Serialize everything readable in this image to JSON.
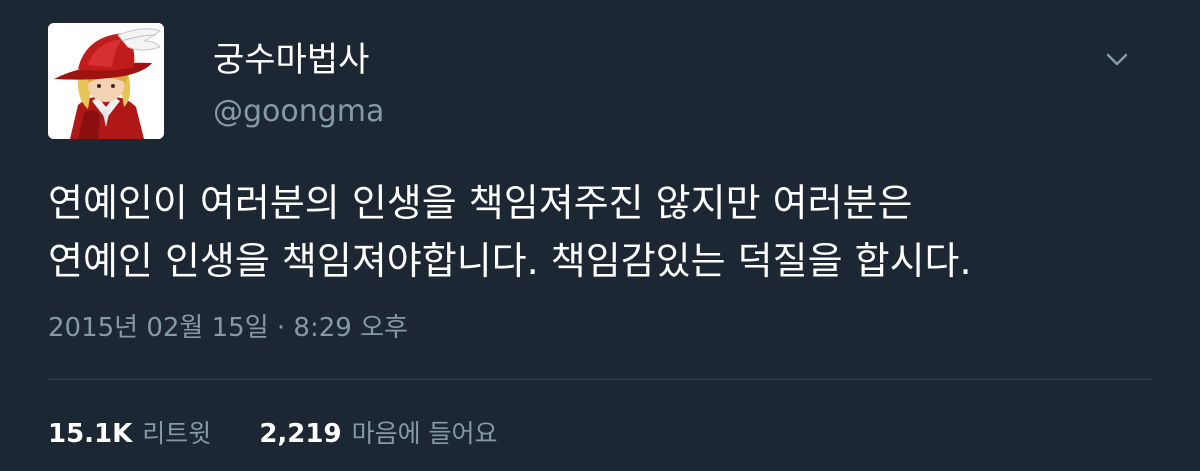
{
  "tweet": {
    "display_name": "궁수마법사",
    "handle": "@goongma",
    "text_lines": [
      "연예인이 여러분의 인생을 책임져주진 않지만 여러분은",
      "연예인 인생을 책임져야합니다. 책임감있는 덕질을 합시다."
    ],
    "timestamp": "2015년 02월 15일 · 8:29 오후",
    "stats": {
      "retweets_count": "15.1K",
      "retweets_label": "리트윗",
      "likes_count": "2,219",
      "likes_label": "마음에 들어요"
    },
    "icons": {
      "menu": "chevron-down-icon",
      "avatar": "red-mage-avatar"
    }
  },
  "colors": {
    "background": "#1c2733",
    "primary_text": "#ffffff",
    "secondary_text": "#8899a6",
    "divider": "#38444d"
  }
}
